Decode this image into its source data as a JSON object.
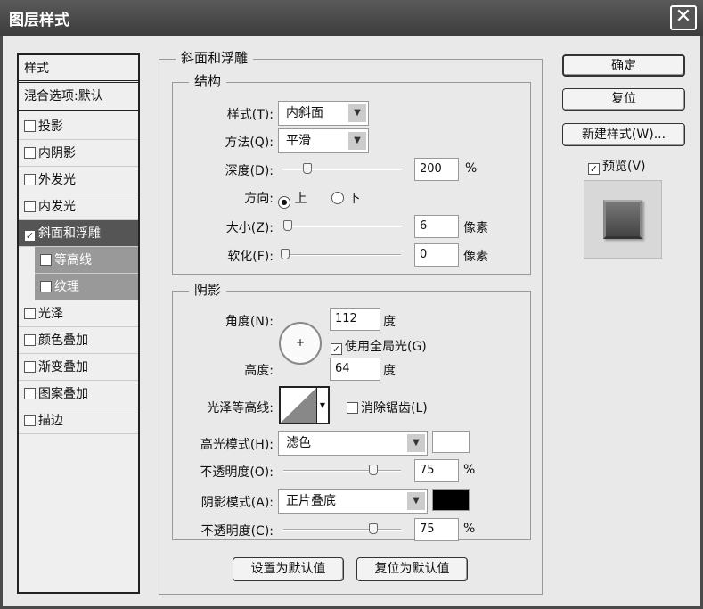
{
  "window": {
    "title": "图层样式",
    "close": "✕"
  },
  "sidebar": {
    "header": "样式",
    "blend": "混合选项:默认",
    "items": [
      {
        "label": "投影",
        "checked": false
      },
      {
        "label": "内阴影",
        "checked": false
      },
      {
        "label": "外发光",
        "checked": false
      },
      {
        "label": "内发光",
        "checked": false
      },
      {
        "label": "斜面和浮雕",
        "checked": true,
        "selected": true
      },
      {
        "label": "等高线",
        "checked": false,
        "sub": true
      },
      {
        "label": "纹理",
        "checked": false,
        "sub": true
      },
      {
        "label": "光泽",
        "checked": false
      },
      {
        "label": "颜色叠加",
        "checked": false
      },
      {
        "label": "渐变叠加",
        "checked": false
      },
      {
        "label": "图案叠加",
        "checked": false
      },
      {
        "label": "描边",
        "checked": false
      }
    ]
  },
  "main": {
    "title": "斜面和浮雕",
    "structure": {
      "title": "结构",
      "style_label": "样式(T):",
      "style_value": "内斜面",
      "method_label": "方法(Q):",
      "method_value": "平滑",
      "depth_label": "深度(D):",
      "depth_value": "200",
      "depth_unit": "%",
      "direction_label": "方向:",
      "dir_up": "上",
      "dir_down": "下",
      "size_label": "大小(Z):",
      "size_value": "6",
      "size_unit": "像素",
      "soften_label": "软化(F):",
      "soften_value": "0",
      "soften_unit": "像素"
    },
    "shading": {
      "title": "阴影",
      "angle_label": "角度(N):",
      "angle_value": "112",
      "angle_unit": "度",
      "global_light": "使用全局光(G)",
      "altitude_label": "高度:",
      "altitude_value": "64",
      "altitude_unit": "度",
      "gloss_label": "光泽等高线:",
      "antialias": "消除锯齿(L)",
      "highlight_label": "高光模式(H):",
      "highlight_value": "滤色",
      "highlight_color": "#ffffff",
      "hopacity_label": "不透明度(O):",
      "hopacity_value": "75",
      "hopacity_unit": "%",
      "shadow_label": "阴影模式(A):",
      "shadow_value": "正片叠底",
      "shadow_color": "#000000",
      "sopacity_label": "不透明度(C):",
      "sopacity_value": "75",
      "sopacity_unit": "%"
    },
    "set_default": "设置为默认值",
    "reset_default": "复位为默认值"
  },
  "right": {
    "ok": "确定",
    "reset": "复位",
    "new_style": "新建样式(W)...",
    "preview": "预览(V)"
  }
}
